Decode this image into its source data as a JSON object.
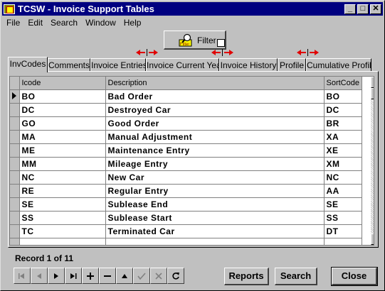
{
  "window": {
    "title": "TCSW - Invoice Support Tables",
    "controls": [
      "_",
      "□",
      "✕"
    ]
  },
  "menu": [
    "File",
    "Edit",
    "Search",
    "Window",
    "Help"
  ],
  "filter": {
    "label": "Filter",
    "icon": "filter-icon",
    "checked": false
  },
  "tabs": [
    "InvCodes",
    "Comments",
    "Invoice Entries",
    "Invoice Current Year",
    "Invoice History",
    "Profile",
    "Cumulative Profile"
  ],
  "grid": {
    "columns": [
      "Icode",
      "Description",
      "SortCode"
    ],
    "rows": [
      [
        "BO",
        "Bad Order",
        "BO"
      ],
      [
        "DC",
        "Destroyed Car",
        "DC"
      ],
      [
        "GO",
        "Good Order",
        "BR"
      ],
      [
        "MA",
        "Manual Adjustment",
        "XA"
      ],
      [
        "ME",
        "Maintenance Entry",
        "XE"
      ],
      [
        "MM",
        "Mileage Entry",
        "XM"
      ],
      [
        "NC",
        "New Car",
        "NC"
      ],
      [
        "RE",
        "Regular Entry",
        "AA"
      ],
      [
        "SE",
        "Sublease End",
        "SE"
      ],
      [
        "SS",
        "Sublease Start",
        "SS"
      ],
      [
        "TC",
        "Terminated Car",
        "DT"
      ]
    ]
  },
  "record_text": "Record 1 of 11",
  "buttons": {
    "reports": "Reports",
    "search": "Search",
    "close": "Close"
  },
  "colors": {
    "title_bar": "#000080",
    "arrow_red": "#e00000"
  }
}
